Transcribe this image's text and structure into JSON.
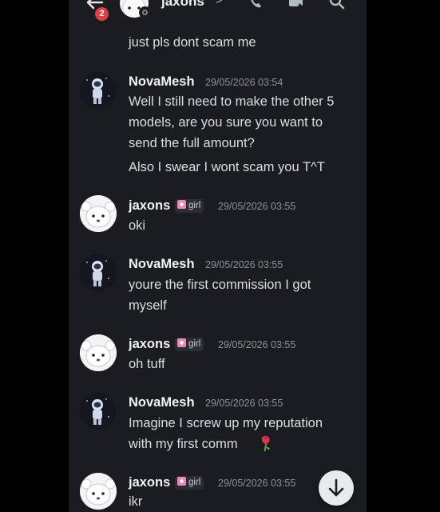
{
  "header": {
    "title": "jaxons",
    "chevron": ">",
    "unread_count": "2",
    "icons": [
      "back-arrow-icon",
      "call-icon",
      "video-icon",
      "search-icon"
    ]
  },
  "messages": [
    {
      "continuation": true,
      "lines": [
        "just pls dont scam me"
      ]
    },
    {
      "author": "NovaMesh",
      "avatar": "astronaut-avatar",
      "time": "29/05/2026 03:54",
      "lines": [
        "Well I still need to make the other 5",
        "models, are you sure you want to",
        "send the full amount?"
      ],
      "extra_line": "Also I swear I wont scam you T^T"
    },
    {
      "author": "jaxons",
      "avatar": "bear-avatar",
      "tag": "girl",
      "time": "29/05/2026 03:55",
      "lines": [
        "oki"
      ]
    },
    {
      "author": "NovaMesh",
      "avatar": "astronaut-avatar",
      "time": "29/05/2026 03:55",
      "lines": [
        "youre the first commission I got",
        "myself"
      ]
    },
    {
      "author": "jaxons",
      "avatar": "bear-avatar",
      "tag": "girl",
      "time": "29/05/2026 03:55",
      "lines": [
        "oh tuff"
      ]
    },
    {
      "author": "NovaMesh",
      "avatar": "astronaut-avatar",
      "time": "29/05/2026 03:55",
      "lines": [
        "Imagine I screw up my reputation",
        "with my first comm"
      ],
      "emoji": "wilted-rose-emoji"
    },
    {
      "author": "jaxons",
      "avatar": "bear-avatar",
      "tag": "girl",
      "time": "29/05/2026 03:55",
      "lines": [
        "ikr"
      ]
    }
  ],
  "colors": {
    "background": "#1b1c22",
    "text": "#dcdde1",
    "name": "#f2f3f5",
    "timestamp": "#8e9099",
    "badge": "#e23d43"
  },
  "scroll_button_icon": "arrow-down-icon"
}
